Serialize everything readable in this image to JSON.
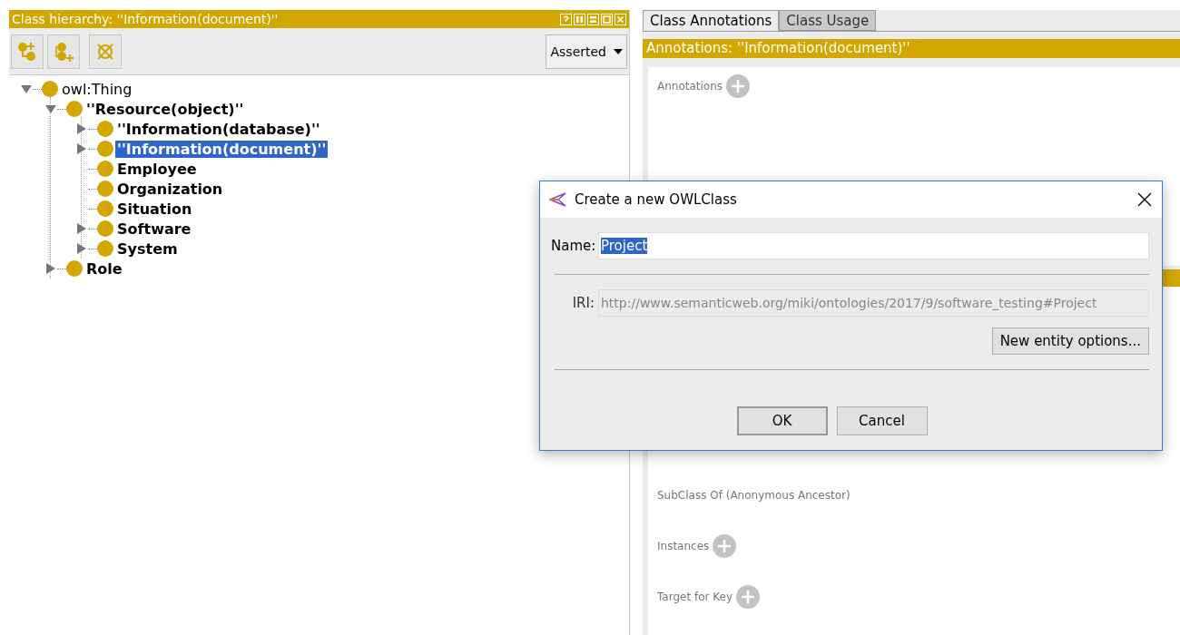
{
  "left_panel": {
    "title": "Class hierarchy: ''Information(document)''",
    "view_selector": {
      "value": "Asserted"
    },
    "tree": [
      {
        "label": "owl:Thing",
        "bold": false,
        "leaf": false,
        "expanded": true,
        "selected": false,
        "children": [
          {
            "label": "''Resource(object)''",
            "bold": true,
            "leaf": false,
            "expanded": true,
            "selected": false,
            "children": [
              {
                "label": "''Information(database)''",
                "bold": true,
                "leaf": false,
                "expanded": false,
                "selected": false
              },
              {
                "label": "''Information(document)''",
                "bold": true,
                "leaf": false,
                "expanded": false,
                "selected": true
              },
              {
                "label": "Employee",
                "bold": true,
                "leaf": true,
                "expanded": false,
                "selected": false
              },
              {
                "label": "Organization",
                "bold": true,
                "leaf": true,
                "expanded": false,
                "selected": false
              },
              {
                "label": "Situation",
                "bold": true,
                "leaf": true,
                "expanded": false,
                "selected": false
              },
              {
                "label": "Software",
                "bold": true,
                "leaf": false,
                "expanded": false,
                "selected": false
              },
              {
                "label": "System",
                "bold": true,
                "leaf": false,
                "expanded": false,
                "selected": false
              }
            ]
          },
          {
            "label": "Role",
            "bold": true,
            "leaf": false,
            "expanded": false,
            "selected": false
          }
        ]
      }
    ]
  },
  "right_panel": {
    "tabs": [
      {
        "label": "Class Annotations",
        "selected": true
      },
      {
        "label": "Class Usage",
        "selected": false
      }
    ],
    "header": "Annotations: ''Information(document)''",
    "annotations_label": "Annotations",
    "sections": [
      {
        "label": "SubClass Of (Anonymous Ancestor)",
        "addable": false
      },
      {
        "label": "Instances",
        "addable": true
      },
      {
        "label": "Target for Key",
        "addable": true
      }
    ]
  },
  "dialog": {
    "title": "Create a new OWLClass",
    "name_label": "Name:",
    "name_value": "Project",
    "iri_label": "IRI:",
    "iri_value": "http://www.semanticweb.org/miki/ontologies/2017/9/software_testing#Project",
    "options_button": "New entity options...",
    "buttons": [
      "OK",
      "Cancel"
    ]
  }
}
